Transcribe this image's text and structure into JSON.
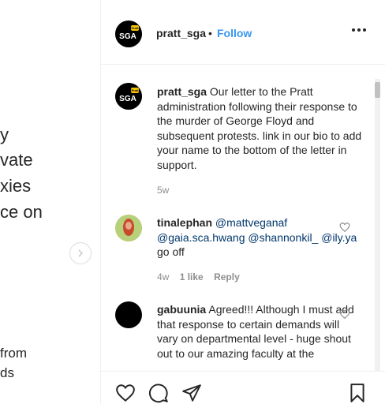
{
  "left_post": {
    "lines": [
      "y",
      "vate",
      "xies",
      "ce on",
      "from",
      "ds"
    ]
  },
  "header": {
    "avatar_text": "SGA",
    "avatar_badge": "Pratt",
    "username": "pratt_sga",
    "separator": "•",
    "follow_label": "Follow"
  },
  "comments": [
    {
      "username": "pratt_sga",
      "text": "Our letter to the Pratt administration following their response to the murder of George Floyd and subsequent protests. link in our bio to add your name to the bottom of the letter in support.",
      "time": "5w"
    },
    {
      "username": "tinalephan",
      "mentions": [
        "@mattveganaf",
        "@gaia.sca.hwang",
        "@shannonkil_",
        "@ily.ya"
      ],
      "text_after": "go off",
      "time": "4w",
      "likes": "1 like",
      "reply": "Reply"
    },
    {
      "username": "gabuunia",
      "text": "Agreed!!! Although I must add that response to certain demands will vary on departmental level - huge shout out to our amazing faculty at the"
    }
  ],
  "icons": {
    "like": "heart-icon",
    "comment": "comment-icon",
    "share": "paper-plane-icon",
    "save": "bookmark-icon",
    "next": "chevron-right-icon"
  },
  "colors": {
    "link": "#3897f0",
    "mention": "#00376b",
    "meta": "#8e8e8e"
  }
}
